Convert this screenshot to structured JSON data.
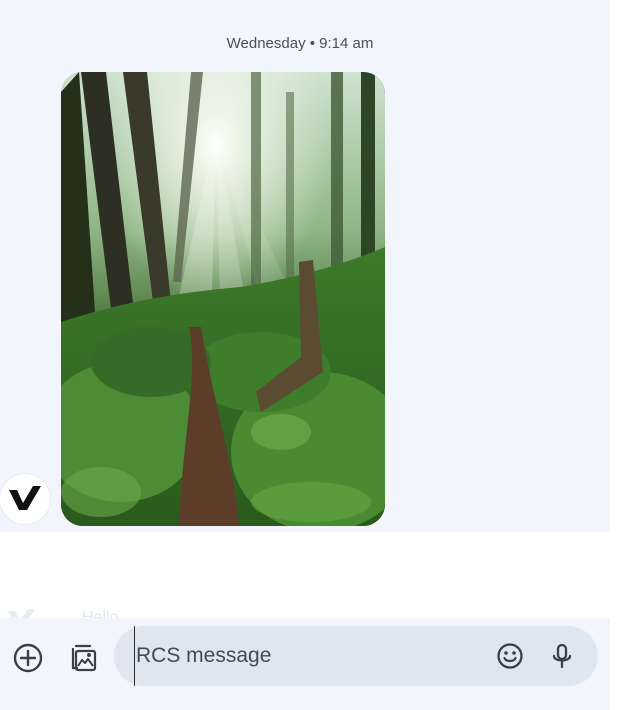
{
  "conversation": {
    "timestamp": "Wednesday • 9:14 am",
    "last_preview": "Hello"
  },
  "composer": {
    "placeholder": "RCS message"
  },
  "icons": {
    "add": "add-circle-icon",
    "gallery": "gallery-icon",
    "emoji": "emoji-icon",
    "mic": "microphone-icon",
    "avatar": "contact-avatar"
  },
  "colors": {
    "chat_background": "#f3f5fc",
    "input_background": "#dde6f1",
    "icon_color": "#3b4048"
  }
}
